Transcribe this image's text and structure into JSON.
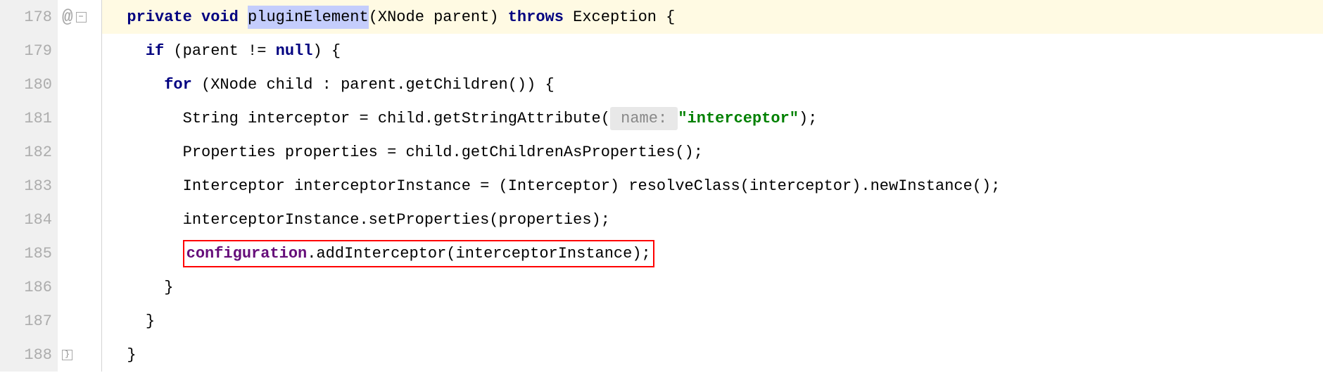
{
  "lines": {
    "178": "178",
    "179": "179",
    "180": "180",
    "181": "181",
    "182": "182",
    "183": "183",
    "184": "184",
    "185": "185",
    "186": "186",
    "187": "187",
    "188": "188"
  },
  "code": {
    "l178": {
      "kw_private": "private",
      "kw_void": "void",
      "method": "pluginElement",
      "params": "(XNode parent) ",
      "kw_throws": "throws",
      "tail": " Exception {"
    },
    "l179": {
      "kw_if": "if",
      "cond_open": " (parent != ",
      "kw_null": "null",
      "cond_close": ") {"
    },
    "l180": {
      "kw_for": "for",
      "rest": " (XNode child : parent.getChildren()) {"
    },
    "l181": {
      "pre": "String interceptor = child.getStringAttribute(",
      "hint": " name: ",
      "str": "\"interceptor\"",
      "post": ");"
    },
    "l182": {
      "text": "Properties properties = child.getChildrenAsProperties();"
    },
    "l183": {
      "text": "Interceptor interceptorInstance = (Interceptor) resolveClass(interceptor).newInstance();"
    },
    "l184": {
      "text": "interceptorInstance.setProperties(properties);"
    },
    "l185": {
      "field": "configuration",
      "rest": ".addInterceptor(interceptorInstance);"
    },
    "l186": {
      "text": "}"
    },
    "l187": {
      "text": "}"
    },
    "l188": {
      "text": "}"
    }
  },
  "icons": {
    "at": "@",
    "minus": "−",
    "brace": "}"
  },
  "watermark": ""
}
